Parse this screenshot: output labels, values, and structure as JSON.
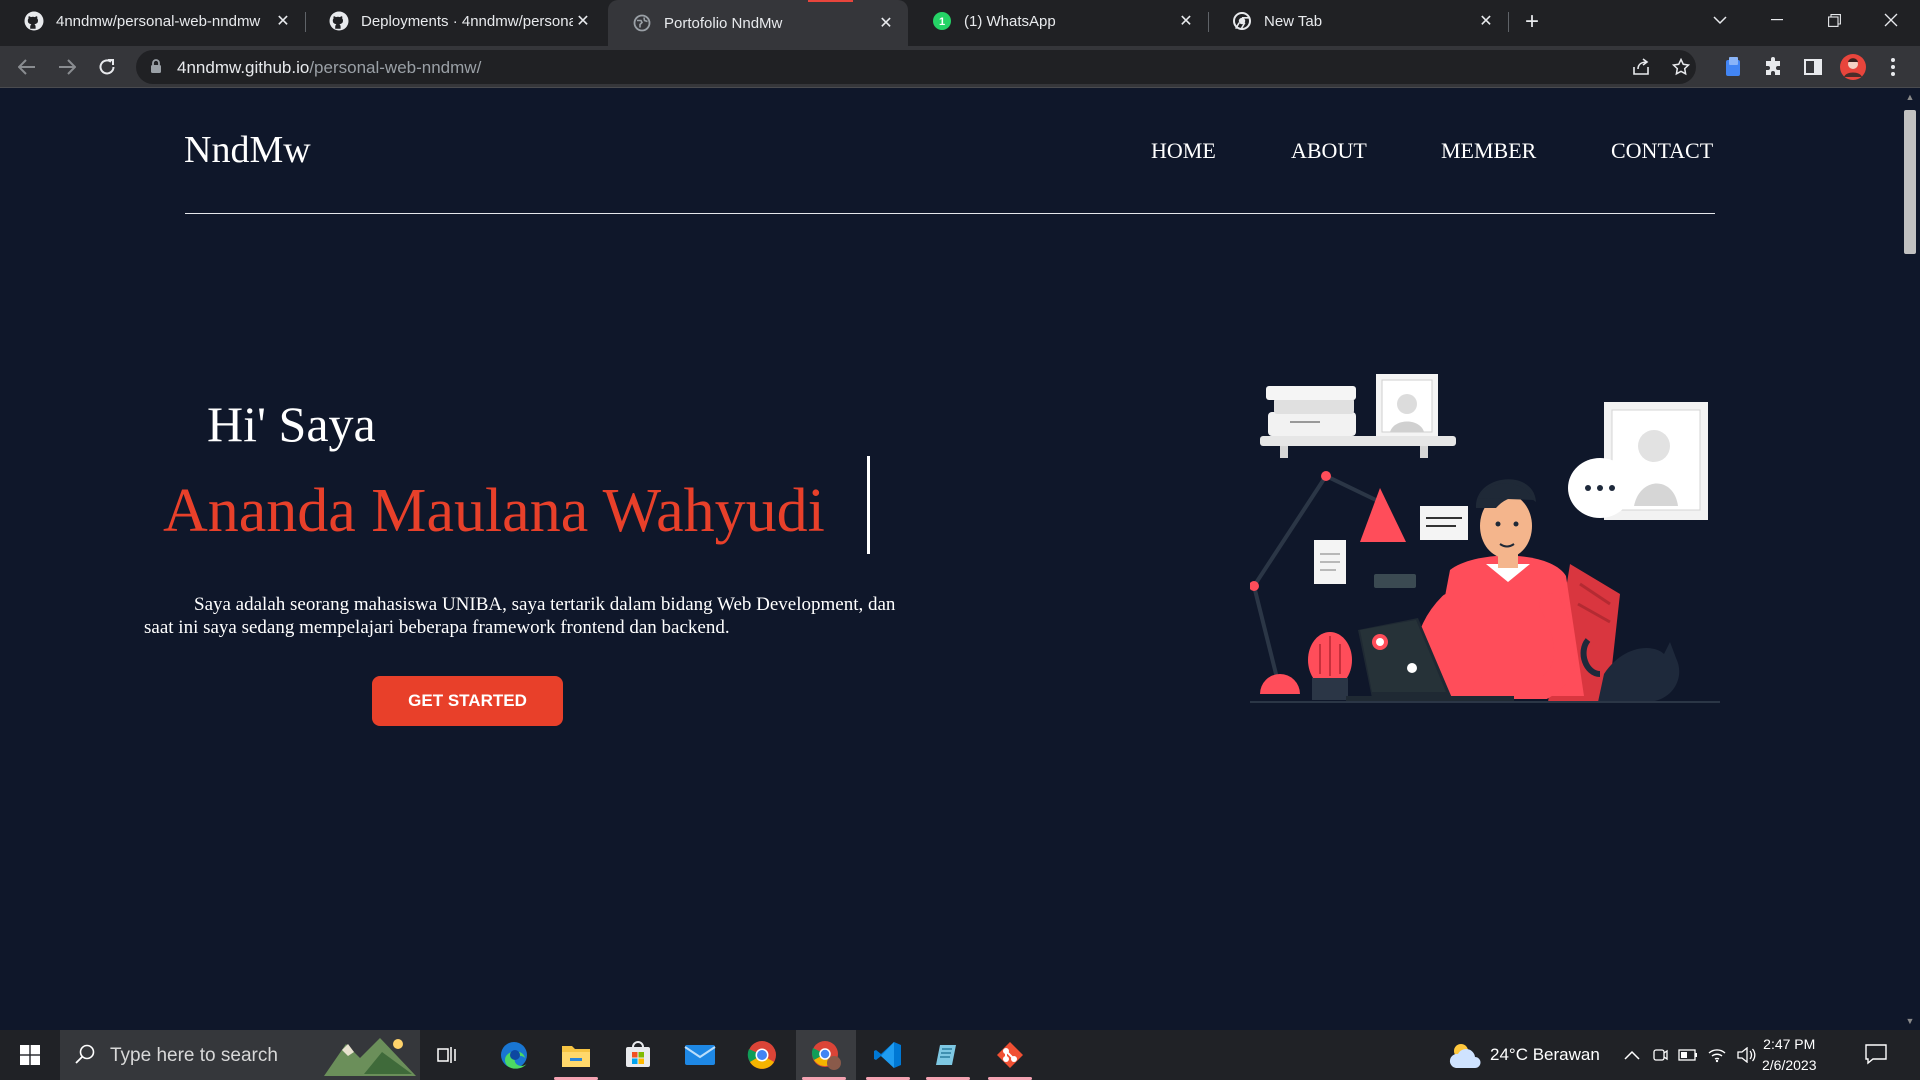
{
  "browser": {
    "tabs": [
      {
        "title": "4nndmw/personal-web-nndmw",
        "icon": "github-icon",
        "active": false
      },
      {
        "title": "Deployments · 4nndmw/personal",
        "icon": "github-icon",
        "active": false
      },
      {
        "title": "Portofolio NndMw",
        "icon": "globe-icon",
        "active": true
      },
      {
        "title": "(1) WhatsApp",
        "icon": "whatsapp-icon",
        "active": false
      },
      {
        "title": "New Tab",
        "icon": "chrome-icon",
        "active": false
      }
    ],
    "url_host": "4nndmw.github.io",
    "url_path": "/personal-web-nndmw/"
  },
  "page": {
    "brand": "NndMw",
    "nav": [
      "HOME",
      "ABOUT",
      "MEMBER",
      "CONTACT"
    ],
    "greeting": "Hi' Saya",
    "name": "Ananda Maulana Wahyudi",
    "bio": "Saya adalah seorang mahasiswa UNIBA, saya tertarik dalam bidang Web Development, dan saat ini saya sedang mempelajari beberapa framework frontend dan backend.",
    "cta": "GET STARTED",
    "colors": {
      "background": "#0f172a",
      "accent": "#e8402a",
      "text": "#ffffff"
    }
  },
  "taskbar": {
    "search_placeholder": "Type here to search",
    "apps": [
      "task-view-icon",
      "edge-icon",
      "file-explorer-icon",
      "store-icon",
      "mail-icon",
      "chrome-icon",
      "chrome-profile-icon",
      "vscode-icon",
      "notepad-icon",
      "git-icon"
    ],
    "weather": "24°C  Berawan",
    "time": "2:47 PM",
    "date": "2/6/2023"
  }
}
